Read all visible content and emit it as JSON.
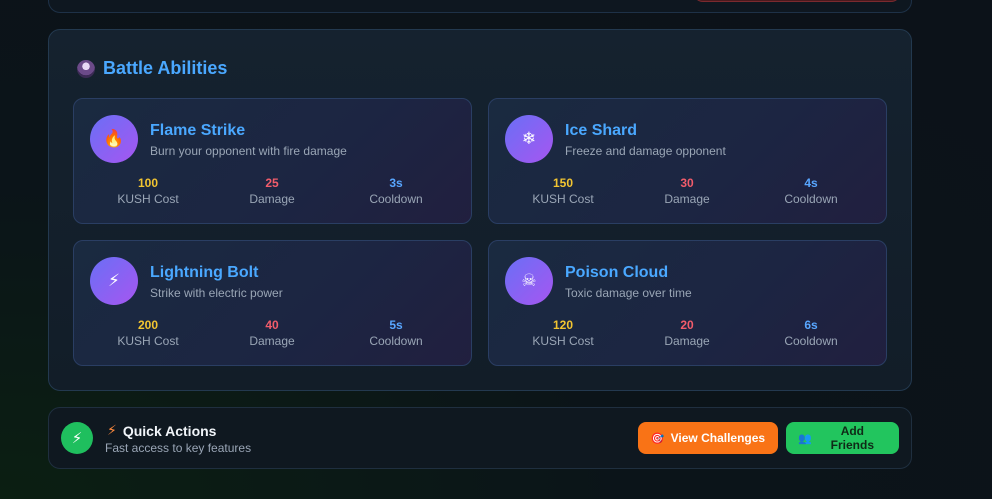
{
  "abilities_panel": {
    "title": "Battle Abilities",
    "icon": "ninja-avatar-icon",
    "abilities": [
      {
        "name": "Flame Strike",
        "description": "Burn your opponent with fire damage",
        "icon": "fire-icon",
        "icon_glyph": "🔥",
        "cost": "100",
        "cost_label": "KUSH Cost",
        "damage": "25",
        "damage_label": "Damage",
        "cooldown": "3s",
        "cooldown_label": "Cooldown"
      },
      {
        "name": "Ice Shard",
        "description": "Freeze and damage opponent",
        "icon": "snowflake-icon",
        "icon_glyph": "❄",
        "cost": "150",
        "cost_label": "KUSH Cost",
        "damage": "30",
        "damage_label": "Damage",
        "cooldown": "4s",
        "cooldown_label": "Cooldown"
      },
      {
        "name": "Lightning Bolt",
        "description": "Strike with electric power",
        "icon": "lightning-icon",
        "icon_glyph": "⚡",
        "cost": "200",
        "cost_label": "KUSH Cost",
        "damage": "40",
        "damage_label": "Damage",
        "cooldown": "5s",
        "cooldown_label": "Cooldown"
      },
      {
        "name": "Poison Cloud",
        "description": "Toxic damage over time",
        "icon": "skull-crossbones-icon",
        "icon_glyph": "☠",
        "cost": "120",
        "cost_label": "KUSH Cost",
        "damage": "20",
        "damage_label": "Damage",
        "cooldown": "6s",
        "cooldown_label": "Cooldown"
      }
    ]
  },
  "quick_actions": {
    "title": "Quick Actions",
    "subtitle": "Fast access to key features",
    "icon_glyph": "⚡",
    "view_challenges_label": "View Challenges",
    "add_friends_label": "Add Friends"
  },
  "colors": {
    "accent_blue": "#4aa8ff",
    "cost_yellow": "#f2c531",
    "damage_red": "#f25c6b",
    "cooldown_blue": "#58a6ff",
    "challenges_orange": "#f97316",
    "friends_green": "#22c55e"
  }
}
